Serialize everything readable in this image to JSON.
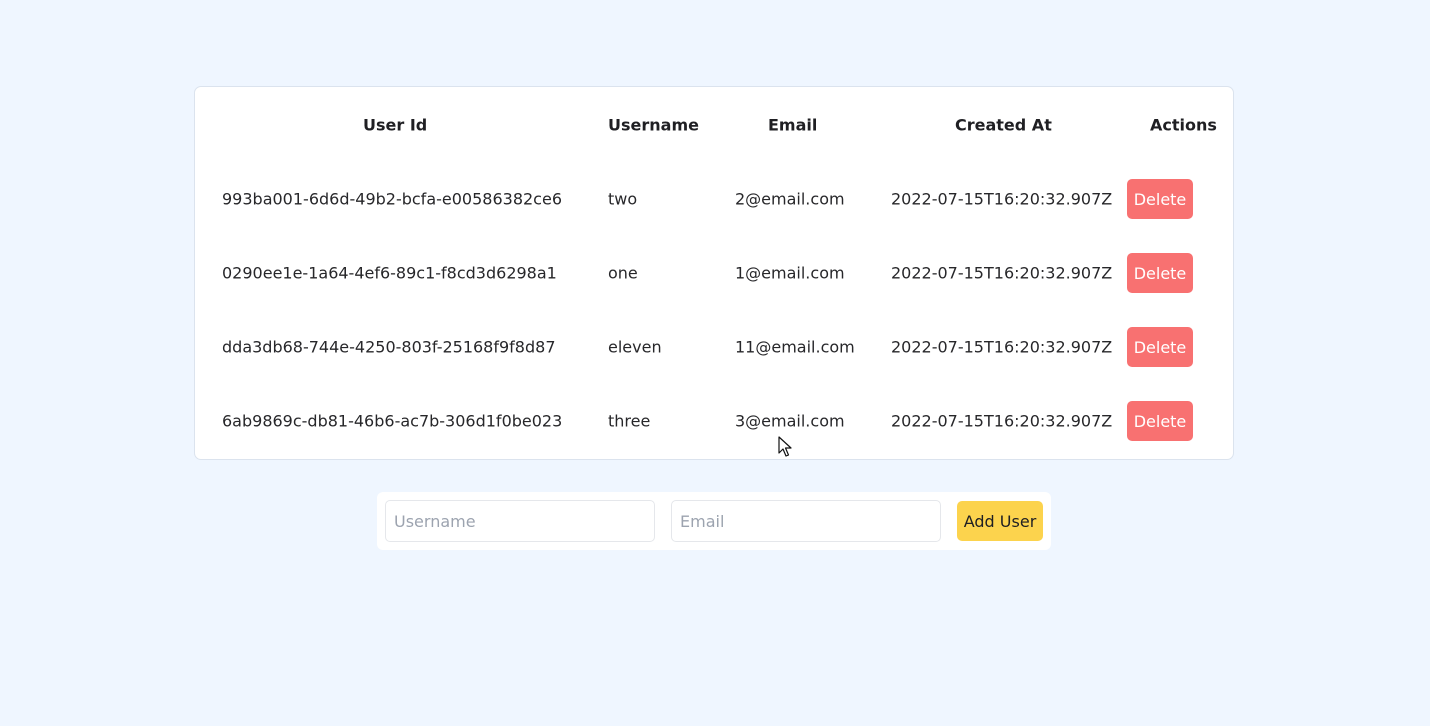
{
  "table": {
    "headers": {
      "user_id": "User Id",
      "username": "Username",
      "email": "Email",
      "created_at": "Created At",
      "actions": "Actions"
    },
    "rows": [
      {
        "user_id": "993ba001-6d6d-49b2-bcfa-e00586382ce6",
        "username": "two",
        "email": "2@email.com",
        "created_at": "2022-07-15T16:20:32.907Z",
        "action_label": "Delete"
      },
      {
        "user_id": "0290ee1e-1a64-4ef6-89c1-f8cd3d6298a1",
        "username": "one",
        "email": "1@email.com",
        "created_at": "2022-07-15T16:20:32.907Z",
        "action_label": "Delete"
      },
      {
        "user_id": "dda3db68-744e-4250-803f-25168f9f8d87",
        "username": "eleven",
        "email": "11@email.com",
        "created_at": "2022-07-15T16:20:32.907Z",
        "action_label": "Delete"
      },
      {
        "user_id": "6ab9869c-db81-46b6-ac7b-306d1f0be023",
        "username": "three",
        "email": "3@email.com",
        "created_at": "2022-07-15T16:20:32.907Z",
        "action_label": "Delete"
      }
    ]
  },
  "form": {
    "username": {
      "value": "",
      "placeholder": "Username"
    },
    "email": {
      "value": "",
      "placeholder": "Email"
    },
    "add_label": "Add User"
  },
  "colors": {
    "background": "#eff6ff",
    "delete_button": "#f87171",
    "add_button": "#fcd34d"
  },
  "icons": {
    "cursor": "mouse-pointer-icon"
  }
}
